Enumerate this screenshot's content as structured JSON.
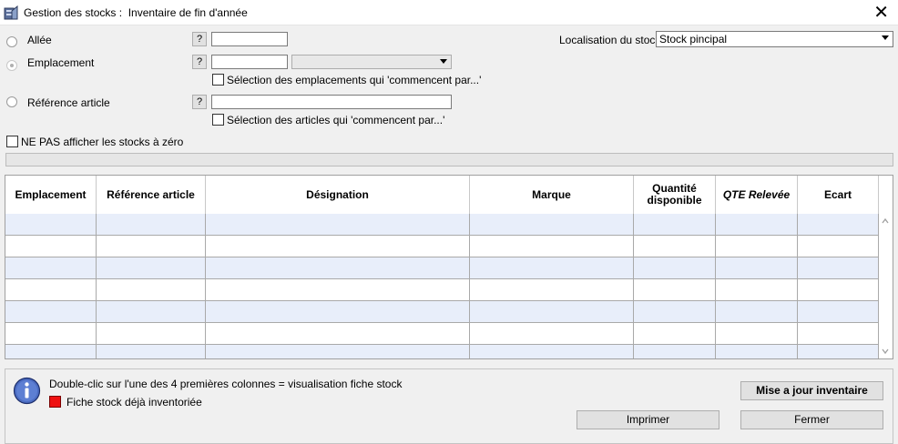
{
  "window": {
    "title": "Gestion des stocks :  Inventaire de fin d'année",
    "close_glyph": "✕"
  },
  "filters": {
    "allee_label": "Allée",
    "emplacement_label": "Emplacement",
    "reference_label": "Référence article",
    "help_glyph": "?",
    "allee_value": "",
    "emplacement_value": "",
    "emplacement_combo_value": "",
    "reference_value": "",
    "chk_emplacements_label": "Sélection des emplacements qui 'commencent par...'",
    "chk_articles_label": "Sélection des articles qui 'commencent par...'",
    "chk_zero_label": "NE PAS afficher les stocks à zéro",
    "localisation_label": "Localisation du stock",
    "localisation_value": "Stock pincipal"
  },
  "grid": {
    "columns": [
      {
        "label": "Emplacement"
      },
      {
        "label": "Référence article"
      },
      {
        "label": "Désignation"
      },
      {
        "label": "Marque"
      },
      {
        "label": "Quantité\ndisponible"
      },
      {
        "label": "QTE Relevée"
      },
      {
        "label": "Ecart"
      }
    ],
    "row_count": 7
  },
  "footer": {
    "info_text": "Double-clic sur l'une des 4 premières colonnes = visualisation fiche stock",
    "legend_text": "Fiche stock déjà inventoriée",
    "legend_color": "#ee1111",
    "update_button": "Mise a jour inventaire",
    "print_button": "Imprimer",
    "close_button": "Fermer"
  },
  "icons": {
    "app": "stock-app-icon",
    "info": "info-icon",
    "close": "close-icon"
  }
}
